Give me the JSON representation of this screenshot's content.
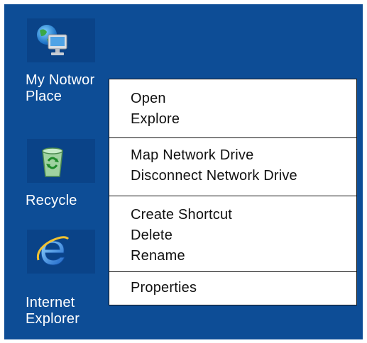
{
  "desktop": {
    "background_color": "#0d4d96",
    "icons": [
      {
        "label": "My Notwor",
        "label_line2": "Place",
        "icon": "network-computer-icon"
      },
      {
        "label": "Recycle",
        "icon": "recycle-bin-icon"
      },
      {
        "label": "Internet",
        "label_line2": "Explorer",
        "icon": "internet-explorer-icon"
      }
    ]
  },
  "context_menu": {
    "groups": [
      {
        "items": [
          "Open",
          "Explore"
        ]
      },
      {
        "items": [
          "Map Network Drive",
          "Disconnect Network Drive"
        ]
      },
      {
        "items": [
          "Create Shortcut",
          "Delete",
          "Rename"
        ]
      },
      {
        "items": [
          "Properties"
        ]
      }
    ]
  }
}
